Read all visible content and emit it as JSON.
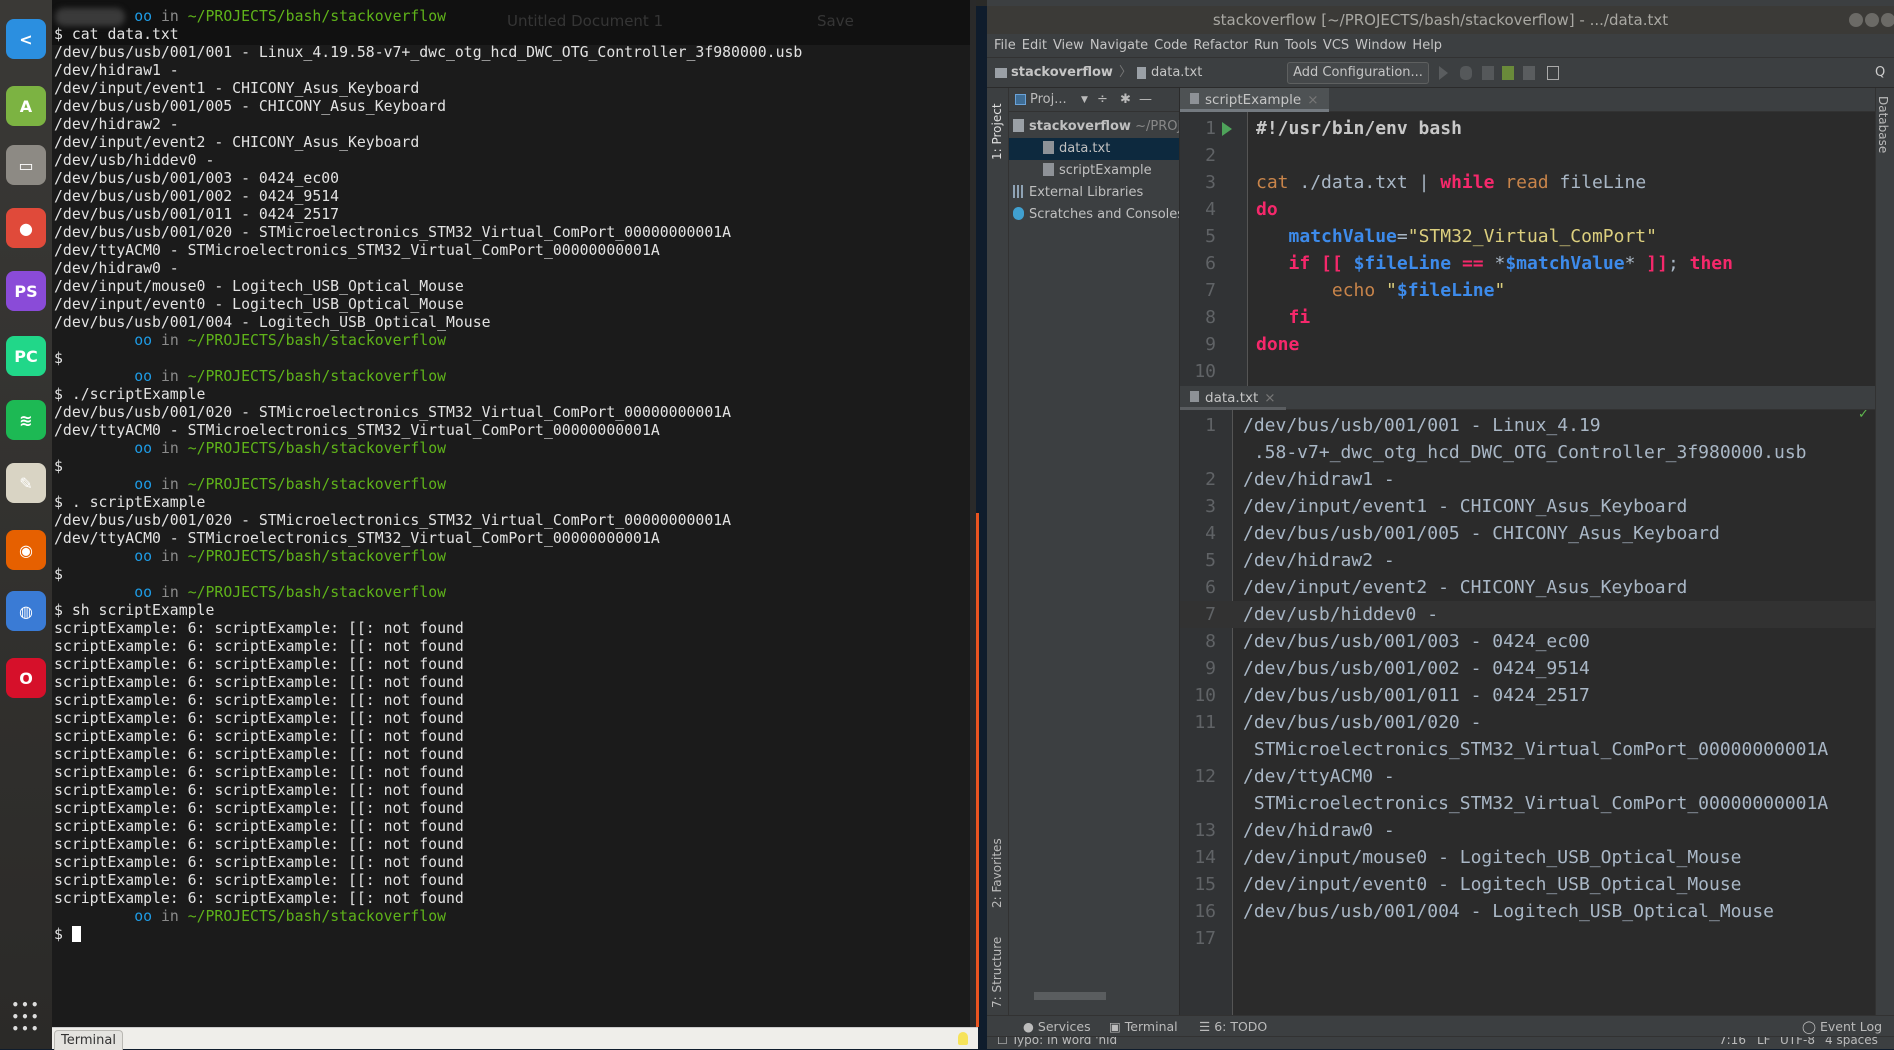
{
  "dock": {
    "items": [
      {
        "name": "vscode",
        "icon": "vscode-icon",
        "color": "#2b8fe0",
        "glyph": "<"
      },
      {
        "name": "android-studio",
        "icon": "android-studio-icon",
        "color": "#7cb342",
        "glyph": "A"
      },
      {
        "name": "files",
        "icon": "files-icon",
        "color": "#8d8a84",
        "glyph": "▭"
      },
      {
        "name": "chrome",
        "icon": "chrome-icon",
        "color": "#e04a3a",
        "glyph": "●"
      },
      {
        "name": "phpstorm",
        "icon": "phpstorm-icon",
        "color": "#8a4bd8",
        "glyph": "PS"
      },
      {
        "name": "pycharm",
        "icon": "pycharm-icon",
        "color": "#21d789",
        "glyph": "PC"
      },
      {
        "name": "spotify",
        "icon": "spotify-icon",
        "color": "#1db954",
        "glyph": "≋"
      },
      {
        "name": "text-editor",
        "icon": "text-editor-icon",
        "color": "#d9d4c4",
        "glyph": "✎"
      },
      {
        "name": "firefox",
        "icon": "firefox-icon",
        "color": "#e66000",
        "glyph": "◉"
      },
      {
        "name": "web-browser",
        "icon": "globe-icon",
        "color": "#3a7bd5",
        "glyph": "◍"
      },
      {
        "name": "opera",
        "icon": "opera-icon",
        "color": "#d6102a",
        "glyph": "O"
      }
    ],
    "apps_grid_icon": "apps-grid-icon"
  },
  "terminal": {
    "ghost_title": "Untitled Document 1",
    "ghost_save": "Save",
    "prompt": {
      "user": "oo",
      "in": "in",
      "path": "~/PROJECTS/bash/stackoverflow"
    },
    "lines": [
      {
        "prompt": true
      },
      "$ cat data.txt",
      "/dev/bus/usb/001/001 - Linux_4.19.58-v7+_dwc_otg_hcd_DWC_OTG_Controller_3f980000.usb",
      "/dev/hidraw1 -",
      "/dev/input/event1 - CHICONY_Asus_Keyboard",
      "/dev/bus/usb/001/005 - CHICONY_Asus_Keyboard",
      "/dev/hidraw2 -",
      "/dev/input/event2 - CHICONY_Asus_Keyboard",
      "/dev/usb/hiddev0 -",
      "/dev/bus/usb/001/003 - 0424_ec00",
      "/dev/bus/usb/001/002 - 0424_9514",
      "/dev/bus/usb/001/011 - 0424_2517",
      "/dev/bus/usb/001/020 - STMicroelectronics_STM32_Virtual_ComPort_00000000001A",
      "/dev/ttyACM0 - STMicroelectronics_STM32_Virtual_ComPort_00000000001A",
      "/dev/hidraw0 -",
      "/dev/input/mouse0 - Logitech_USB_Optical_Mouse",
      "/dev/input/event0 - Logitech_USB_Optical_Mouse",
      "/dev/bus/usb/001/004 - Logitech_USB_Optical_Mouse",
      {
        "prompt": true
      },
      "$",
      {
        "prompt": true
      },
      "$ ./scriptExample",
      "/dev/bus/usb/001/020 - STMicroelectronics_STM32_Virtual_ComPort_00000000001A",
      "/dev/ttyACM0 - STMicroelectronics_STM32_Virtual_ComPort_00000000001A",
      {
        "prompt": true
      },
      "$",
      {
        "prompt": true
      },
      "$ . scriptExample",
      "/dev/bus/usb/001/020 - STMicroelectronics_STM32_Virtual_ComPort_00000000001A",
      "/dev/ttyACM0 - STMicroelectronics_STM32_Virtual_ComPort_00000000001A",
      {
        "prompt": true
      },
      "$",
      {
        "prompt": true
      },
      "$ sh scriptExample",
      "scriptExample: 6: scriptExample: [[: not found",
      "scriptExample: 6: scriptExample: [[: not found",
      "scriptExample: 6: scriptExample: [[: not found",
      "scriptExample: 6: scriptExample: [[: not found",
      "scriptExample: 6: scriptExample: [[: not found",
      "scriptExample: 6: scriptExample: [[: not found",
      "scriptExample: 6: scriptExample: [[: not found",
      "scriptExample: 6: scriptExample: [[: not found",
      "scriptExample: 6: scriptExample: [[: not found",
      "scriptExample: 6: scriptExample: [[: not found",
      "scriptExample: 6: scriptExample: [[: not found",
      "scriptExample: 6: scriptExample: [[: not found",
      "scriptExample: 6: scriptExample: [[: not found",
      "scriptExample: 6: scriptExample: [[: not found",
      "scriptExample: 6: scriptExample: [[: not found",
      "scriptExample: 6: scriptExample: [[: not found",
      {
        "prompt": true
      },
      {
        "cursor": true,
        "text": "$ "
      }
    ],
    "tab_label": "Terminal"
  },
  "ide": {
    "window_title": "stackoverflow [~/PROJECTS/bash/stackoverflow] - .../data.txt",
    "menu": [
      "File",
      "Edit",
      "View",
      "Navigate",
      "Code",
      "Refactor",
      "Run",
      "Tools",
      "VCS",
      "Window",
      "Help"
    ],
    "breadcrumb": {
      "project": "stackoverflow",
      "file": "data.txt"
    },
    "add_configuration": "Add Configuration...",
    "left_stripe": {
      "project": "1: Project",
      "favorites": "2: Favorites",
      "structure": "7: Structure"
    },
    "right_stripe": {
      "database": "Database"
    },
    "project_panel": {
      "header": "Proj...",
      "root": {
        "name": "stackoverflow",
        "path": "~/PROJECTS/bash/stackoverflow"
      },
      "items": [
        {
          "label": "data.txt",
          "icon": "text-file-icon",
          "selected": true
        },
        {
          "label": "scriptExample",
          "icon": "script-file-icon",
          "selected": false
        }
      ],
      "external_libraries": "External Libraries",
      "scratches": "Scratches and Consoles"
    },
    "script_tab": "scriptExample",
    "script_lines": [
      [
        [
          "#!/usr/bin/env bash",
          "sheb"
        ]
      ],
      [],
      [
        [
          "cat",
          "cmd"
        ],
        [
          " ./data.txt ",
          "plain"
        ],
        [
          "|",
          "plain"
        ],
        [
          " ",
          "plain"
        ],
        [
          "while",
          "kw"
        ],
        [
          " ",
          "plain"
        ],
        [
          "read",
          "cmd"
        ],
        [
          " fileLine",
          "plain"
        ]
      ],
      [
        [
          "do",
          "kw"
        ]
      ],
      [
        [
          "   ",
          "plain"
        ],
        [
          "matchValue",
          "var"
        ],
        [
          "=",
          "plain"
        ],
        [
          "\"STM32_Virtual_ComPort\"",
          "str"
        ]
      ],
      [
        [
          "   ",
          "plain"
        ],
        [
          "if",
          "kw"
        ],
        [
          " ",
          "plain"
        ],
        [
          "[[",
          "kw"
        ],
        [
          " ",
          "plain"
        ],
        [
          "$fileLine",
          "var"
        ],
        [
          " ",
          "plain"
        ],
        [
          "==",
          "kw"
        ],
        [
          " *",
          "plain"
        ],
        [
          "$matchValue",
          "var"
        ],
        [
          "* ",
          "plain"
        ],
        [
          "]]",
          "kw"
        ],
        [
          "; ",
          "plain"
        ],
        [
          "then",
          "kw"
        ]
      ],
      [
        [
          "       ",
          "plain"
        ],
        [
          "echo",
          "cmd"
        ],
        [
          " \"",
          "str"
        ],
        [
          "$fileLine",
          "var"
        ],
        [
          "\"",
          "str"
        ]
      ],
      [
        [
          "   ",
          "plain"
        ],
        [
          "fi",
          "kw"
        ]
      ],
      [
        [
          "done",
          "kw"
        ]
      ],
      []
    ],
    "data_tab": "data.txt",
    "data_lines": [
      {
        "n": "1",
        "text": "/dev/bus/usb/001/001 - Linux_4.19",
        "cont": " .58-v7+_dwc_otg_hcd_DWC_OTG_Controller_3f980000.usb"
      },
      {
        "n": "2",
        "text": "/dev/hidraw1 -"
      },
      {
        "n": "3",
        "text": "/dev/input/event1 - CHICONY_Asus_Keyboard"
      },
      {
        "n": "4",
        "text": "/dev/bus/usb/001/005 - CHICONY_Asus_Keyboard"
      },
      {
        "n": "5",
        "text": "/dev/hidraw2 -"
      },
      {
        "n": "6",
        "text": "/dev/input/event2 - CHICONY_Asus_Keyboard"
      },
      {
        "n": "7",
        "text": "/dev/usb/hiddev0 -",
        "current": true
      },
      {
        "n": "8",
        "text": "/dev/bus/usb/001/003 - 0424_ec00"
      },
      {
        "n": "9",
        "text": "/dev/bus/usb/001/002 - 0424_9514"
      },
      {
        "n": "10",
        "text": "/dev/bus/usb/001/011 - 0424_2517"
      },
      {
        "n": "11",
        "text": "/dev/bus/usb/001/020 -",
        "cont": " STMicroelectronics_STM32_Virtual_ComPort_00000000001A"
      },
      {
        "n": "12",
        "text": "/dev/ttyACM0 -",
        "cont": " STMicroelectronics_STM32_Virtual_ComPort_00000000001A"
      },
      {
        "n": "13",
        "text": "/dev/hidraw0 -"
      },
      {
        "n": "14",
        "text": "/dev/input/mouse0 - Logitech_USB_Optical_Mouse"
      },
      {
        "n": "15",
        "text": "/dev/input/event0 - Logitech_USB_Optical_Mouse"
      },
      {
        "n": "16",
        "text": "/dev/bus/usb/001/004 - Logitech_USB_Optical_Mouse"
      },
      {
        "n": "17",
        "text": ""
      }
    ],
    "bottom_tools": {
      "services": "Services",
      "terminal": "Terminal",
      "todo": "6: TODO",
      "event_log": "Event Log"
    },
    "status": {
      "message": "Typo: In word 'hid",
      "position": "7:16",
      "line_sep": "LF",
      "encoding": "UTF-8",
      "indent": "4 spaces"
    }
  }
}
